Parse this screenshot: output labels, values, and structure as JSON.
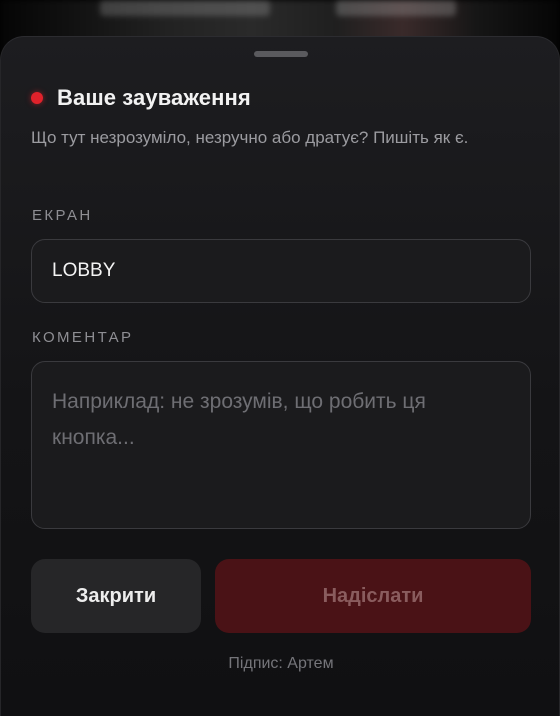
{
  "sheet": {
    "title": "Ваше зауваження",
    "subtitle": "Що тут незрозуміло, незручно або дратує? Пишіть як є.",
    "status_dot_color": "#e0222b"
  },
  "screen_field": {
    "label": "ЕКРАН",
    "value": "LOBBY"
  },
  "comment_field": {
    "label": "КОМЕНТАР",
    "placeholder": "Наприклад: не зрозумів, що робить ця кнопка..."
  },
  "actions": {
    "close_label": "Закрити",
    "send_label": "Надіслати"
  },
  "footer": {
    "signature": "Підпис: Артем"
  }
}
